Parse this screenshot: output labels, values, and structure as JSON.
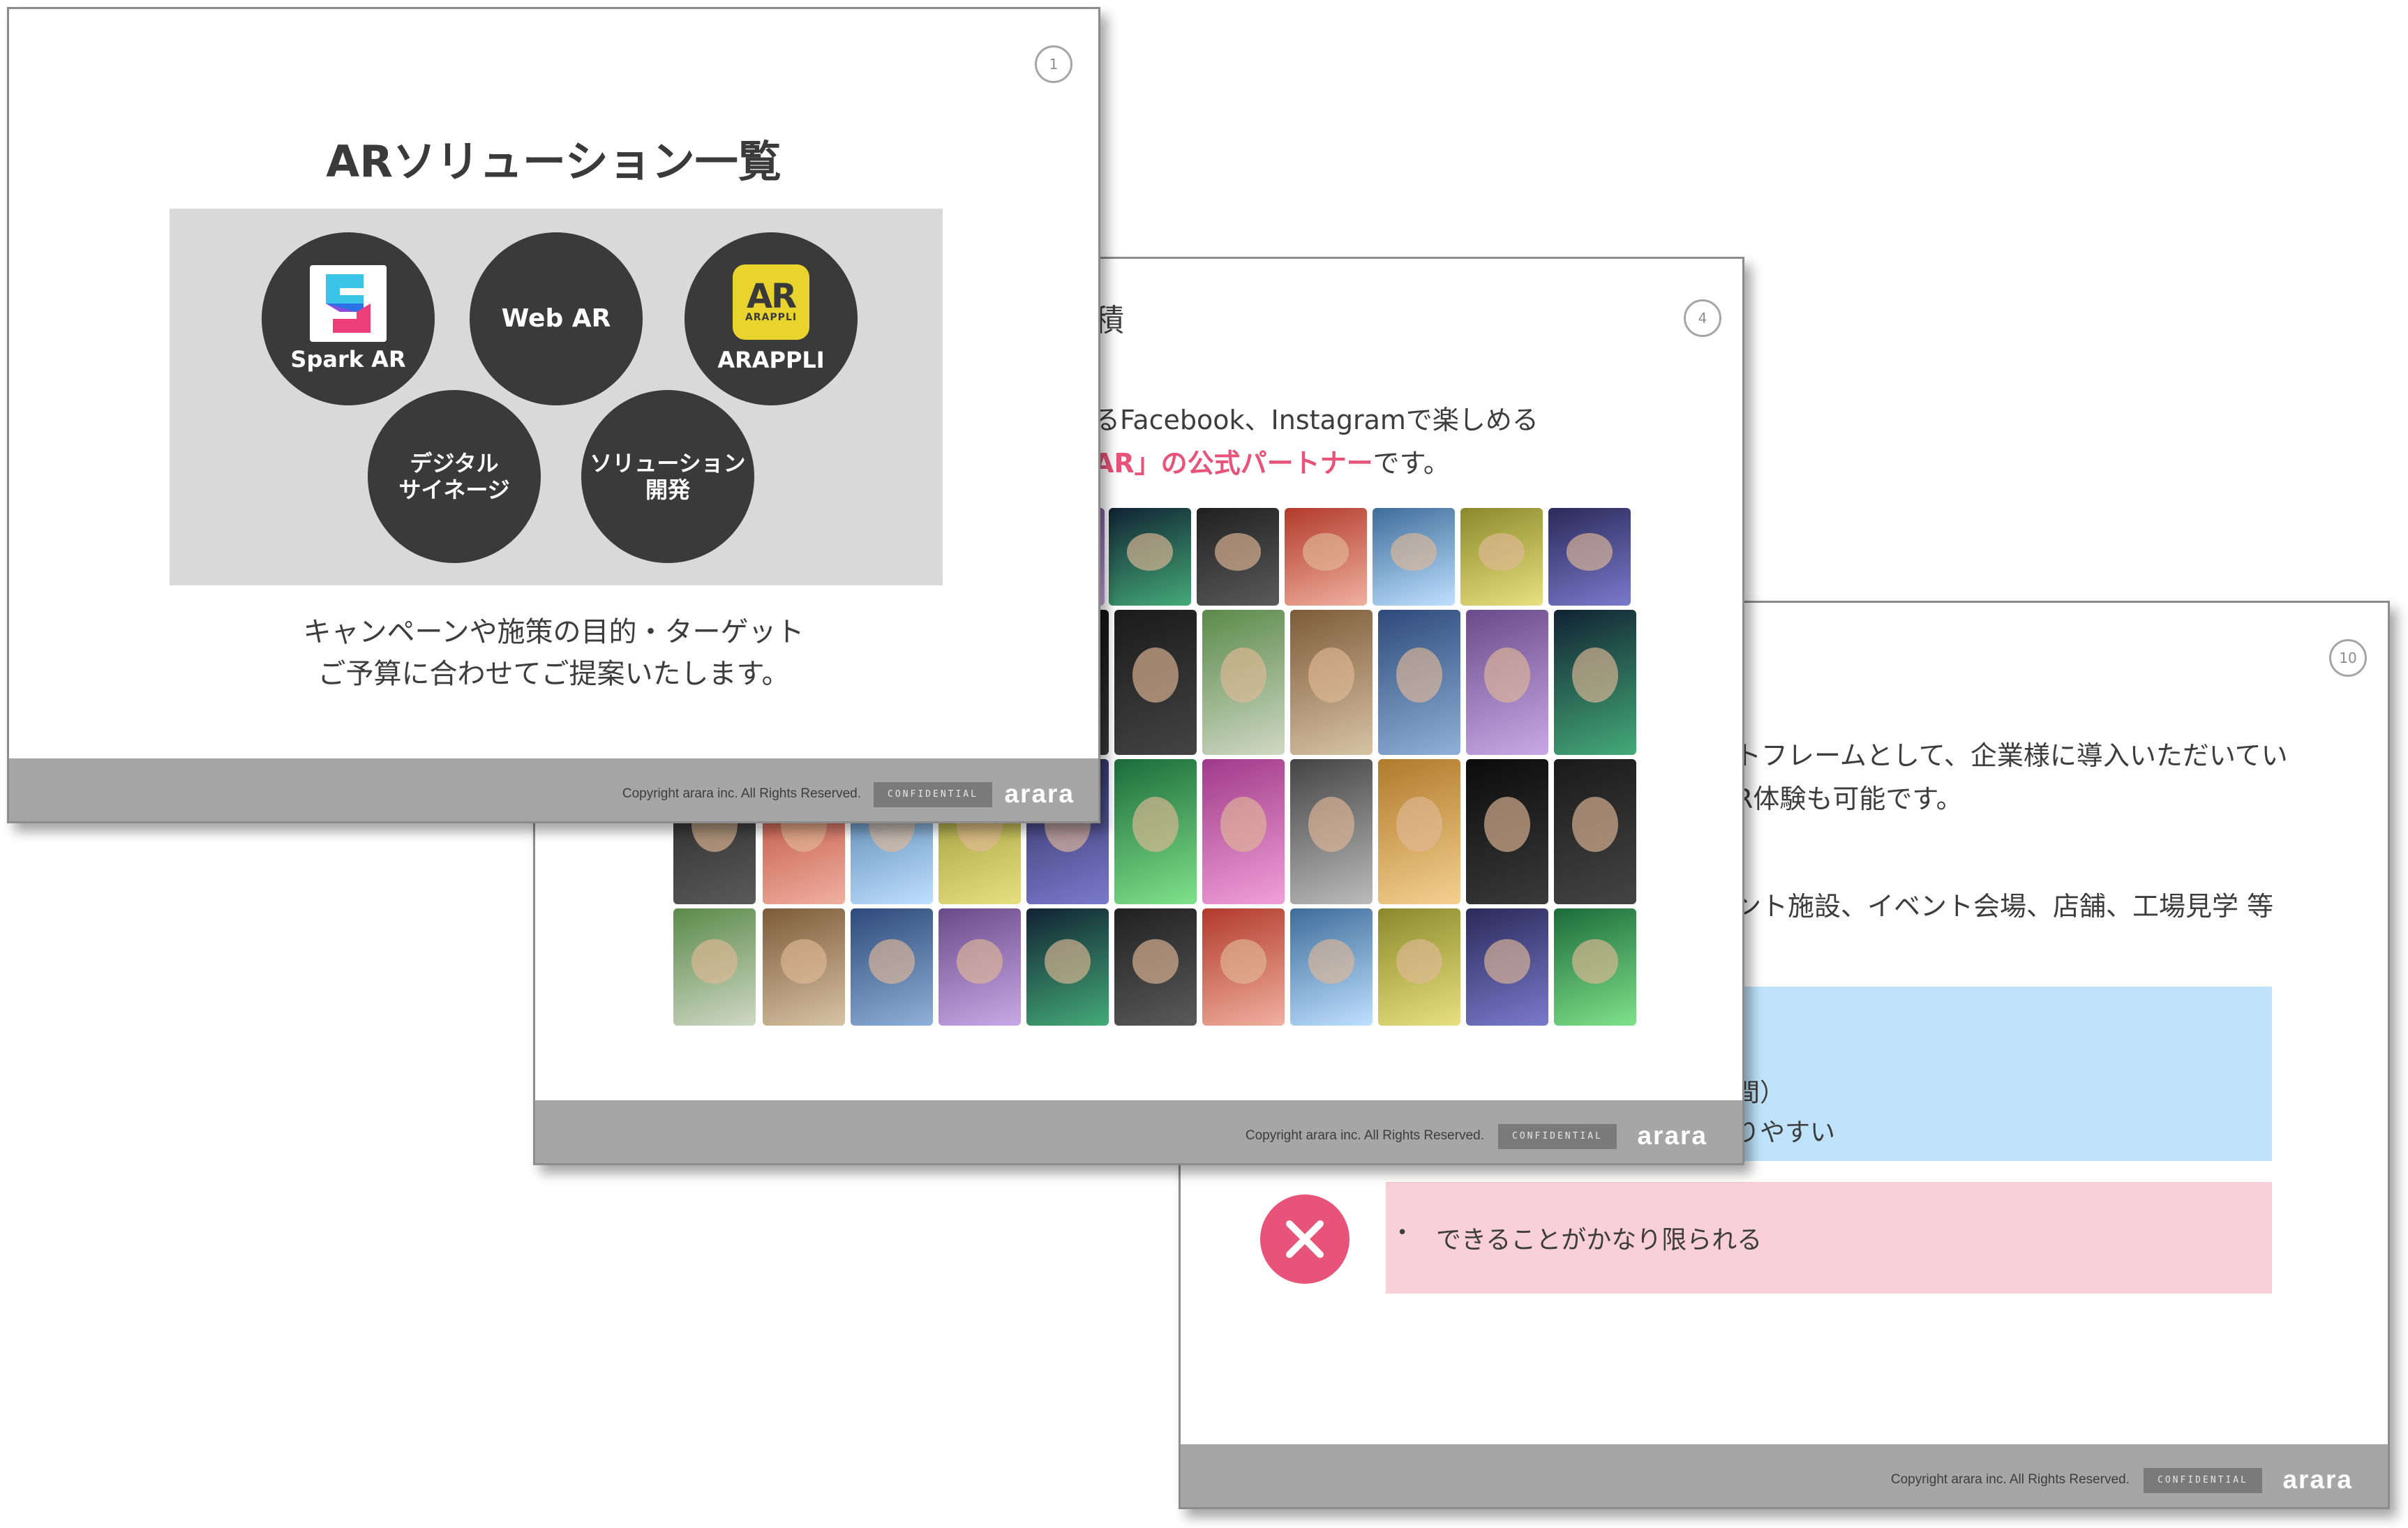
{
  "slide1": {
    "page_num": "1",
    "title": "ARソリューション一覧",
    "solutions": [
      {
        "label": "Spark AR",
        "icon": "spark-ar-logo"
      },
      {
        "label": "Web AR"
      },
      {
        "label": "ARAPPLI",
        "icon": "arappli-logo",
        "logo_main": "AR",
        "logo_sub": "ARAPPLI"
      },
      {
        "label_lines": [
          "デジタル",
          "サイネージ"
        ]
      },
      {
        "label_lines": [
          "ソリューション",
          "開発"
        ]
      }
    ],
    "caption_lines": [
      "キャンペーンや施策の目的・ターゲット",
      "ご予算に合わせてご提案いたします。"
    ],
    "footer": {
      "copyright": "Copyright arara inc. All Rights Reserved.",
      "confidential": "CONFIDENTIAL",
      "brand": "arara"
    }
  },
  "slide2": {
    "page_num": "4",
    "title_fragment": "積",
    "line1": "るFacebook、Instagramで楽しめる",
    "line2_highlight": "AR」の公式パートナー",
    "line2_rest": "です。",
    "footer": {
      "copyright": "Copyright arara inc. All Rights Reserved.",
      "confidential": "CONFIDENTIAL",
      "brand": "arara"
    }
  },
  "slide3": {
    "page_num": "10",
    "line1": "トフレームとして、企業様に導入いただいてい",
    "line2": "R体験も可能です。",
    "line3": "ント施設、イベント会場、店舗、工場見学 等",
    "pro_fragment1": "間）",
    "pro_fragment2": "りやすい",
    "con_bullet": "•",
    "con_text": "できることがかなり限られる",
    "footer": {
      "copyright": "Copyright arara inc. All Rights Reserved.",
      "confidential": "CONFIDENTIAL",
      "brand": "arara"
    }
  },
  "colors": {
    "accent_pink": "#e8537a",
    "circle_dark": "#3a3a3a",
    "panel_gray": "#d9d9d9",
    "footer_gray": "#a6a6a6",
    "pro_blue": "#bfe3fa",
    "con_pink": "#f9d0da",
    "arappli_yellow": "#e8d42c"
  }
}
